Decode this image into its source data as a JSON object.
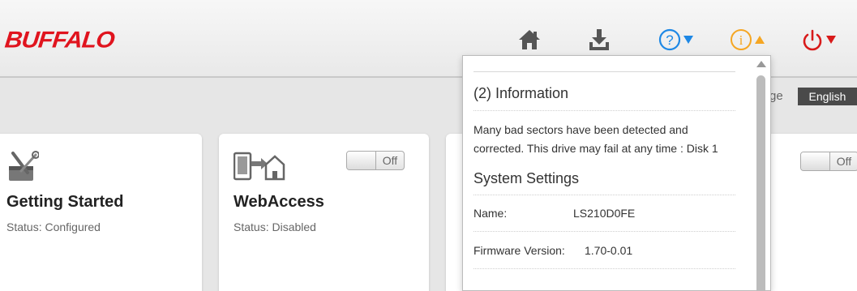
{
  "header": {
    "logo": "BUFFALO",
    "icons": [
      "home-icon",
      "download-icon",
      "help-icon",
      "info-icon",
      "power-icon"
    ],
    "colors": {
      "brand": "#e0141e",
      "help": "#1e88e5",
      "info": "#f5a623",
      "power": "#d81a1a"
    }
  },
  "language": {
    "label": "Language",
    "selected": "English"
  },
  "cards": [
    {
      "title": "Getting Started",
      "status": "Status: Configured",
      "icon": "tools-icon"
    },
    {
      "title": "WebAccess",
      "status": "Status: Disabled",
      "icon": "webaccess-icon",
      "toggle": "Off"
    },
    {
      "toggle": "Off"
    }
  ],
  "panel": {
    "info_heading": "(2) Information",
    "info_message": "Many bad sectors have been detected and corrected. This drive may fail at any time : Disk 1",
    "settings_heading": "System Settings",
    "rows": [
      {
        "key": "Name:",
        "value": "LS210D0FE"
      },
      {
        "key": "Firmware Version:",
        "value": "1.70-0.01"
      }
    ]
  }
}
